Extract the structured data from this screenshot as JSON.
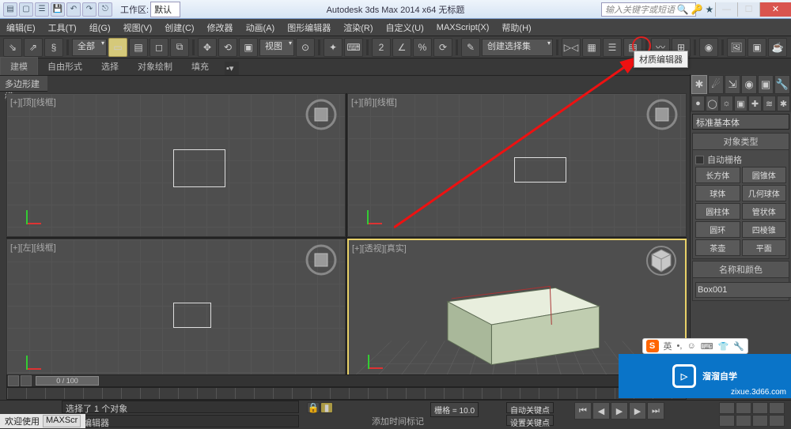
{
  "titlebar": {
    "workspace_label": "工作区: ",
    "workspace_value": "默认",
    "title": "Autodesk 3ds Max 2014 x64     无标题",
    "search_placeholder": "输入关键字或短语"
  },
  "menus": [
    "编辑(E)",
    "工具(T)",
    "组(G)",
    "视图(V)",
    "创建(C)",
    "修改器",
    "动画(A)",
    "图形编辑器",
    "渲染(R)",
    "自定义(U)",
    "MAXScript(X)",
    "帮助(H)"
  ],
  "toolbar": {
    "selection_filter": "全部",
    "view_mode": "视图",
    "selset": "创建选择集"
  },
  "ribbon": {
    "tabs": [
      "建模",
      "自由形式",
      "选择",
      "对象绘制",
      "填充"
    ],
    "polybar": "多边形建模"
  },
  "viewports": {
    "top": "[+][顶][线框]",
    "front": "[+][前][线框]",
    "left": "[+][左][线框]",
    "persp": "[+][透视][真实]"
  },
  "cmdpanel": {
    "category": "标准基本体",
    "roll_objtype": "对象类型",
    "autogrid": "自动栅格",
    "objects": [
      "长方体",
      "圆锥体",
      "球体",
      "几何球体",
      "圆柱体",
      "管状体",
      "圆环",
      "四棱锥",
      "茶壶",
      "平面"
    ],
    "roll_name": "名称和颜色",
    "objname": "Box001"
  },
  "timeslider": {
    "thumb": "0 / 100"
  },
  "status": {
    "welcome": "欢迎使用",
    "maxscript": "MAXScr",
    "prompt": "选择了 1 个对象",
    "minilistener": "材质编辑器",
    "addtimetag": "添加时间标记",
    "grid": "栅格 = 10.0",
    "autokey": "自动关键点",
    "setkey": "设置关键点"
  },
  "callout": "材质编辑器",
  "watermark": {
    "text": "溜溜自学",
    "url": "zixue.3d66.com"
  },
  "ime": {
    "lang": "英"
  }
}
